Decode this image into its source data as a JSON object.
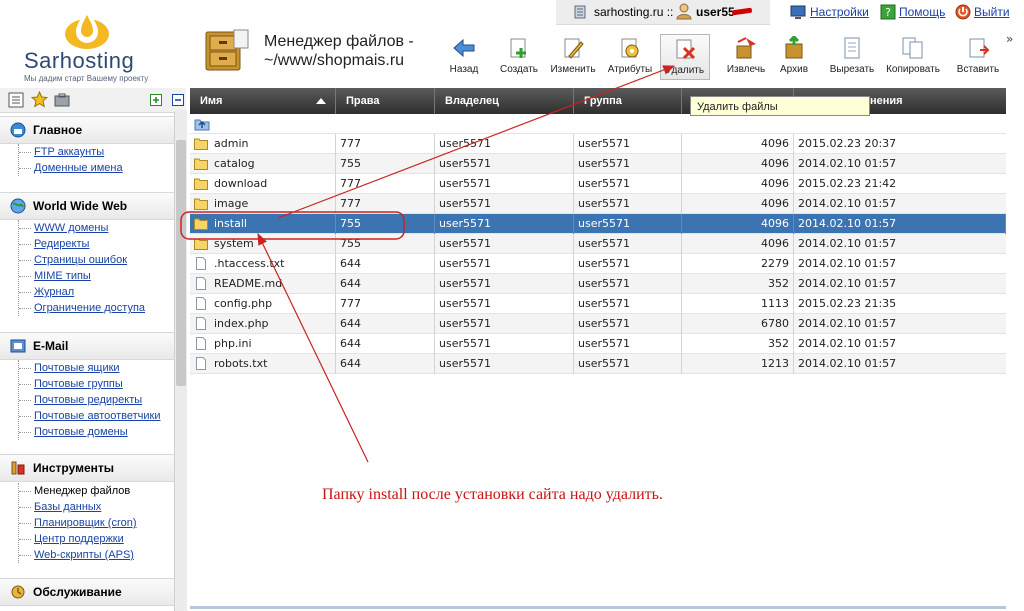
{
  "logo": {
    "name": "Sarhosting",
    "slogan": "Мы дадим старт Вашему проекту"
  },
  "page": {
    "title_line1": "Менеджер файлов -",
    "title_line2": "~/www/shopmais.ru"
  },
  "userbar": {
    "host": "sarhosting.ru ::",
    "user": "user55"
  },
  "top_links": {
    "settings": "Настройки",
    "help": "Помощь",
    "logout": "Выйти"
  },
  "toolbar": [
    {
      "label": "Назад",
      "icon": "back-arrow-icon"
    },
    {
      "label": "Создать",
      "icon": "create-file-icon"
    },
    {
      "label": "Изменить",
      "icon": "edit-icon"
    },
    {
      "label": "Атрибуты",
      "icon": "attributes-icon"
    },
    {
      "label": "Удалить",
      "icon": "delete-icon"
    },
    {
      "label": "Извлечь",
      "icon": "extract-icon"
    },
    {
      "label": "Архив",
      "icon": "archive-icon"
    },
    {
      "label": "Вырезать",
      "icon": "cut-icon"
    },
    {
      "label": "Копировать",
      "icon": "copy-icon"
    },
    {
      "label": "Вставить",
      "icon": "paste-icon"
    }
  ],
  "tooltip": "Удалить файлы",
  "sidebar": {
    "sections": [
      {
        "title": "Главное",
        "icon": "home-icon",
        "items": [
          "FTP аккаунты",
          "Доменные имена"
        ]
      },
      {
        "title": "World Wide Web",
        "icon": "globe-icon",
        "items": [
          "WWW домены",
          "Редиректы",
          "Страницы ошибок",
          "MIME типы",
          "Журнал",
          "Ограничение доступа"
        ]
      },
      {
        "title": "E-Mail",
        "icon": "mail-icon",
        "items": [
          "Почтовые ящики",
          "Почтовые группы",
          "Почтовые редиректы",
          "Почтовые автоответчики",
          "Почтовые домены"
        ]
      },
      {
        "title": "Инструменты",
        "icon": "tools-icon",
        "items": [
          "Менеджер файлов",
          "Базы данных",
          "Планировщик (cron)",
          "Центр поддержки",
          "Web-скрипты (APS)"
        ]
      },
      {
        "title": "Обслуживание",
        "icon": "service-icon",
        "items": []
      }
    ]
  },
  "table": {
    "headers": [
      "Имя",
      "Права",
      "Владелец",
      "Группа",
      "",
      "нения"
    ],
    "rows": [
      {
        "name": "admin",
        "type": "folder",
        "perm": "777",
        "owner": "user5571",
        "group": "user5571",
        "size": "4096",
        "date": "2015.02.23 20:37"
      },
      {
        "name": "catalog",
        "type": "folder",
        "perm": "755",
        "owner": "user5571",
        "group": "user5571",
        "size": "4096",
        "date": "2014.02.10 01:57"
      },
      {
        "name": "download",
        "type": "folder",
        "perm": "777",
        "owner": "user5571",
        "group": "user5571",
        "size": "4096",
        "date": "2015.02.23 21:42"
      },
      {
        "name": "image",
        "type": "folder",
        "perm": "777",
        "owner": "user5571",
        "group": "user5571",
        "size": "4096",
        "date": "2014.02.10 01:57"
      },
      {
        "name": "install",
        "type": "folder",
        "perm": "755",
        "owner": "user5571",
        "group": "user5571",
        "size": "4096",
        "date": "2014.02.10 01:57"
      },
      {
        "name": "system",
        "type": "folder",
        "perm": "755",
        "owner": "user5571",
        "group": "user5571",
        "size": "4096",
        "date": "2014.02.10 01:57"
      },
      {
        "name": ".htaccess.txt",
        "type": "file",
        "perm": "644",
        "owner": "user5571",
        "group": "user5571",
        "size": "2279",
        "date": "2014.02.10 01:57"
      },
      {
        "name": "README.md",
        "type": "file",
        "perm": "644",
        "owner": "user5571",
        "group": "user5571",
        "size": "352",
        "date": "2014.02.10 01:57"
      },
      {
        "name": "config.php",
        "type": "file",
        "perm": "777",
        "owner": "user5571",
        "group": "user5571",
        "size": "1113",
        "date": "2015.02.23 21:35"
      },
      {
        "name": "index.php",
        "type": "file",
        "perm": "644",
        "owner": "user5571",
        "group": "user5571",
        "size": "6780",
        "date": "2014.02.10 01:57"
      },
      {
        "name": "php.ini",
        "type": "file",
        "perm": "644",
        "owner": "user5571",
        "group": "user5571",
        "size": "352",
        "date": "2014.02.10 01:57"
      },
      {
        "name": "robots.txt",
        "type": "file",
        "perm": "644",
        "owner": "user5571",
        "group": "user5571",
        "size": "1213",
        "date": "2014.02.10 01:57"
      }
    ],
    "selected": "install"
  },
  "annotation": "Папку install после установки сайта надо удалить.",
  "colors": {
    "accent": "#1a43a6",
    "selection": "#3b74b0",
    "annotation": "#cc1111",
    "header_bg": "#3a3a3a"
  }
}
